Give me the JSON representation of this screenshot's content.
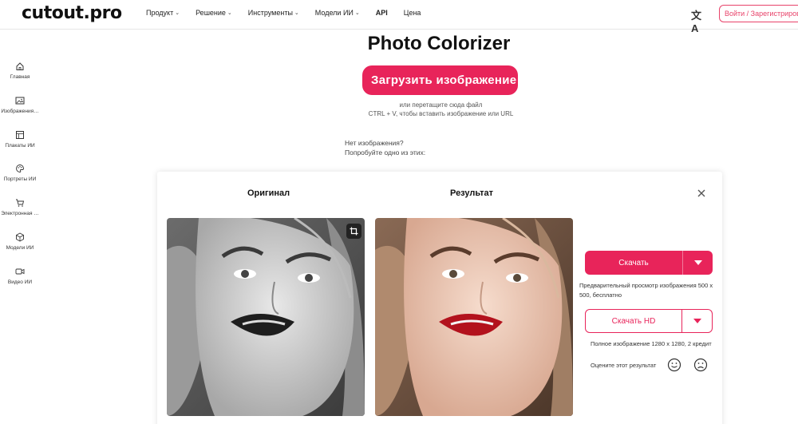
{
  "header": {
    "logo": "cutout.pro",
    "nav": [
      {
        "label": "Продукт",
        "caret": "⌄"
      },
      {
        "label": "Решение",
        "caret": "⌄"
      },
      {
        "label": "Инструменты",
        "caret": "⌄"
      },
      {
        "label": "Модели ИИ",
        "caret": "⌄"
      },
      {
        "label": "API",
        "caret": ""
      },
      {
        "label": "Цена",
        "caret": ""
      }
    ],
    "language_icon": "文A",
    "login_label": "Войти / Зарегистрироваться"
  },
  "sidebar": {
    "items": [
      {
        "label": "Главная",
        "icon": "home-icon"
      },
      {
        "label": "Изображения…",
        "icon": "image-icon"
      },
      {
        "label": "Плакаты ИИ",
        "icon": "poster-icon"
      },
      {
        "label": "Портреты ИИ",
        "icon": "palette-icon"
      },
      {
        "label": "Электронная …",
        "icon": "cart-icon"
      },
      {
        "label": "Модели ИИ",
        "icon": "cube-icon"
      },
      {
        "label": "Видео ИИ",
        "icon": "video-icon"
      }
    ]
  },
  "hero": {
    "title": "Photo Colorizer",
    "upload_label": "Загрузить изображение",
    "hint_drag": "или перетащите сюда файл",
    "hint_paste": "CTRL + V, чтобы вставить изображение или URL",
    "no_image_line1": "Нет изображения?",
    "no_image_line2": "Попробуйте одно из этих:"
  },
  "panel": {
    "original_title": "Оригинал",
    "result_title": "Результат",
    "download_label": "Скачать",
    "preview_note": "Предварительный просмотр изображения 500 x 500, бесплатно",
    "download_hd_label": "Скачать HD",
    "full_note": "Полное изображение 1280 x 1280, 2 кредит",
    "rate_label": "Оцените этот результат"
  },
  "colors": {
    "accent": "#e8245a",
    "text": "#222222"
  }
}
